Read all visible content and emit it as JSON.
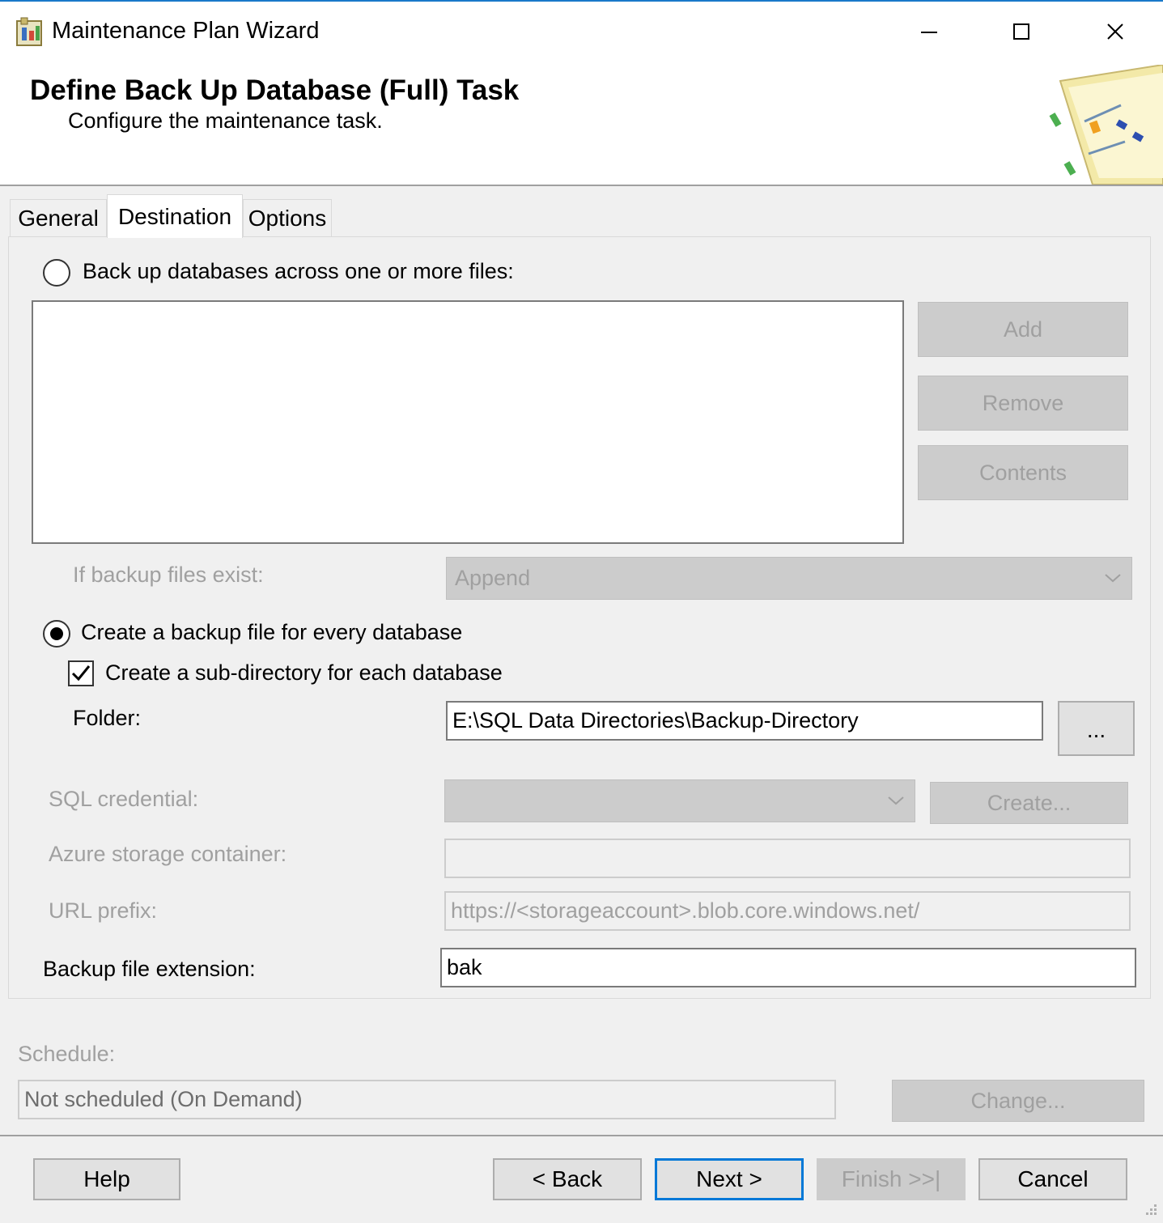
{
  "window": {
    "title": "Maintenance Plan Wizard",
    "icon": "maintenance-plan-icon",
    "controls": [
      "minimize-icon",
      "maximize-icon",
      "close-icon"
    ]
  },
  "header": {
    "title": "Define Back Up Database (Full) Task",
    "subtitle": "Configure the maintenance task."
  },
  "tabs": [
    {
      "label": "General",
      "active": false
    },
    {
      "label": "Destination",
      "active": true
    },
    {
      "label": "Options",
      "active": false
    }
  ],
  "destination": {
    "across_files_label": "Back up databases across one or more files:",
    "across_files_selected": false,
    "add_label": "Add",
    "remove_label": "Remove",
    "contents_label": "Contents",
    "if_exist_label": "If backup files exist:",
    "if_exist_value": "Append",
    "every_db_label": "Create a backup file for every database",
    "every_db_selected": true,
    "subdir_label": "Create a sub-directory for each database",
    "subdir_checked": true,
    "folder_label": "Folder:",
    "folder_value": "E:\\SQL Data Directories\\Backup-Directory",
    "browse_label": "...",
    "credential_label": "SQL credential:",
    "credential_value": "",
    "create_label": "Create...",
    "azure_label": "Azure storage container:",
    "azure_value": "",
    "url_label": "URL prefix:",
    "url_value": "https://<storageaccount>.blob.core.windows.net/",
    "ext_label": "Backup file extension:",
    "ext_value": "bak"
  },
  "schedule": {
    "label": "Schedule:",
    "value": "Not scheduled (On Demand)",
    "change_label": "Change..."
  },
  "footer": {
    "help": "Help",
    "back": "< Back",
    "next": "Next >",
    "finish": "Finish >>|",
    "cancel": "Cancel"
  },
  "colors": {
    "accent": "#0078d7",
    "window_bg": "#f0f0f0",
    "disabled_text": "#a0a0a0",
    "disabled_fill": "#cccccc"
  }
}
